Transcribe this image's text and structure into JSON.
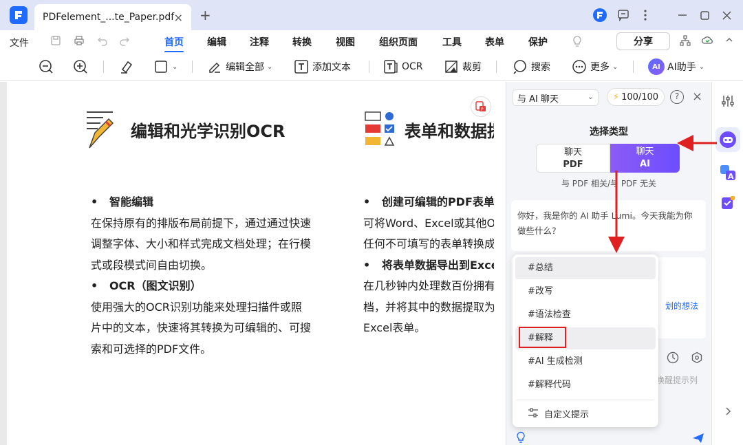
{
  "titlebar": {
    "tab_title": "PDFelement_...te_Paper.pdf",
    "tab_close": "×",
    "new_tab": "+"
  },
  "menubar": {
    "file": "文件",
    "items": [
      "首页",
      "编辑",
      "注释",
      "转换",
      "视图",
      "组织页面",
      "工具",
      "表单",
      "保护"
    ],
    "active": "首页",
    "share": "分享"
  },
  "toolbar": {
    "edit_all": "编辑全部",
    "add_text": "添加文本",
    "ocr": "OCR",
    "crop": "裁剪",
    "search": "搜索",
    "more": "更多",
    "ai_assistant": "AI助手",
    "ai_badge": "AI"
  },
  "document": {
    "section1_title": "编辑和光学识别OCR",
    "section2_title": "表单和数据提",
    "col1": [
      {
        "bullet": true,
        "text": "智能编辑"
      },
      {
        "bullet": false,
        "text": "在保持原有的排版布局前提下，通过通过快速"
      },
      {
        "bullet": false,
        "text": "调整字体、大小和样式完成文档处理；在行模"
      },
      {
        "bullet": false,
        "text": "式或段模式间自由切换。"
      },
      {
        "bullet": true,
        "text": "OCR（图文识别）"
      },
      {
        "bullet": false,
        "text": "使用强大的OCR识别功能来处理扫描件或照"
      },
      {
        "bullet": false,
        "text": "片中的文本，快速将其转换为可编辑的、可搜"
      },
      {
        "bullet": false,
        "text": "索和可选择的PDF文件。"
      }
    ],
    "col2": [
      {
        "bullet": true,
        "text": "创建可编辑的PDF表单"
      },
      {
        "bullet": false,
        "text": "可将Word、Excel或其他O"
      },
      {
        "bullet": false,
        "text": "任何不可填写的表单转换成"
      },
      {
        "bullet": true,
        "text": "将表单数据导出到Exce"
      },
      {
        "bullet": false,
        "text": "在几秒钟内处理数百份拥有"
      },
      {
        "bullet": false,
        "text": "档，并将其中的数据提取为"
      },
      {
        "bullet": false,
        "text": "Excel表单。"
      }
    ],
    "bullet_char": "•"
  },
  "ai_panel": {
    "chat_mode": "与 AI 聊天",
    "credits": "100/100",
    "help": "?",
    "close": "×",
    "select_type": "选择类型",
    "type_pdf_line1": "聊天",
    "type_pdf_line2": "PDF",
    "type_ai_line1": "聊天",
    "type_ai_line2": "AI",
    "type_desc": "与 PDF 相关/与 PDF 无关",
    "greeting": "你好，我是你的 AI 助手 Lumi。今天我能为你做些什么？",
    "input_hint": "划的想法",
    "prompt_hint": "唤醒提示列"
  },
  "dropdown": {
    "items": [
      "#总结",
      "#改写",
      "#语法检查",
      "#解释",
      "#AI 生成检测",
      "#解释代码"
    ],
    "custom": "自定义提示"
  },
  "colors": {
    "accent": "#1f6bff",
    "ai_gradient_start": "#8b5cf6",
    "ai_gradient_end": "#6d4dff",
    "annotation_red": "#e02020",
    "titlebar_bg": "#dfe4f7"
  }
}
